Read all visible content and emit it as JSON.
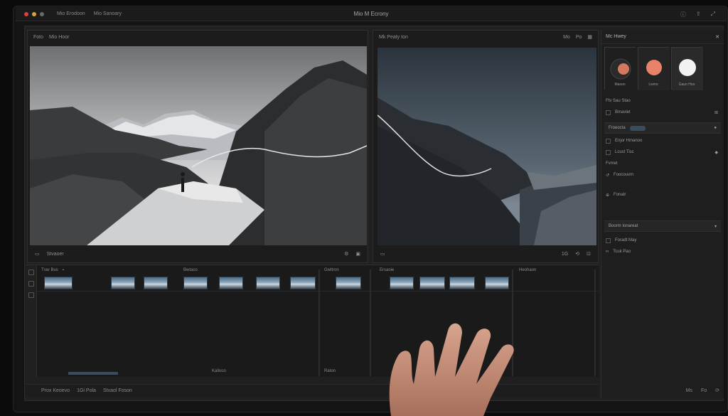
{
  "titlebar": {
    "menu": [
      "Mio Erodoon",
      "Mio Sanoary"
    ],
    "title": "Mio M Ecrony"
  },
  "viewer_left": {
    "header": [
      "Foto",
      "Mio Hoor"
    ],
    "footer_label": "Stvaoer"
  },
  "viewer_right": {
    "header": "Mk Peaty ton",
    "header_tools": [
      "Mo",
      "Po"
    ],
    "footer_tools": [
      "1G"
    ]
  },
  "timeline": {
    "tracks": [
      "Trav Bus",
      "Bwtaco",
      "Gwltron",
      "Ersaoie",
      "Heohaon"
    ],
    "bottom_labels": [
      "Kalloco",
      "Raton"
    ],
    "footer": [
      "Prox Keoevo",
      "1Gi Pola",
      "Stvaol Foson"
    ]
  },
  "inspector": {
    "title": "Mc Hwey",
    "thumb_labels": [
      "Mason",
      "Lwmo",
      "Gaun Hoo"
    ],
    "rows": [
      "Ftv Sau Stao",
      "Bmaviet",
      "Froeocta",
      "Enjor Hmanoo",
      "Lcust Tisc",
      "Fvmet",
      "Foocouvm",
      "Fonatr",
      "Boorm Ionareat",
      "Foradt May",
      "Tcuk Pao"
    ],
    "bottom": [
      "Ms",
      "Fo"
    ]
  },
  "colors": {
    "accent": "#3b4c5e",
    "close": "#d9433a",
    "minimize": "#d9a53a"
  }
}
